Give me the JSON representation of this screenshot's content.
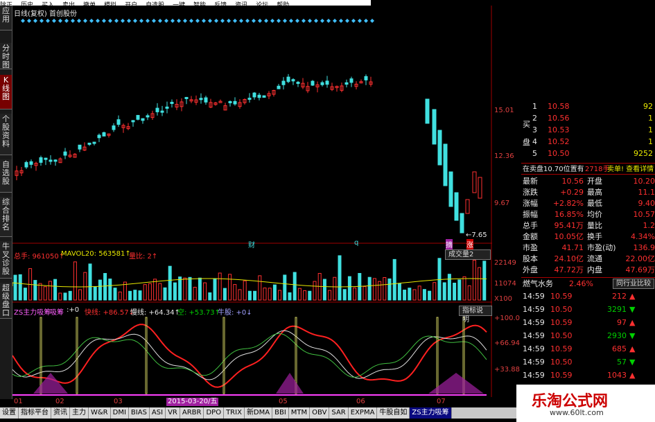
{
  "top_menu": [
    "除正",
    "历史",
    "买入",
    "卖出",
    "撤单",
    "模拟",
    "开户",
    "自选股",
    "一键",
    "智能",
    "反馈",
    "资讯",
    "论坛",
    "帮助"
  ],
  "left_tabs": [
    {
      "label": "应用",
      "active": false
    },
    {
      "label": "分时图",
      "active": false
    },
    {
      "label": "K线图",
      "active": true
    },
    {
      "label": "个股资料",
      "active": false
    },
    {
      "label": "自选股",
      "active": false
    },
    {
      "label": "综合排名",
      "active": false
    },
    {
      "label": "牛叉诊股",
      "active": false
    },
    {
      "label": "超级盘口",
      "active": false
    }
  ],
  "chart": {
    "header": "日线(复权)  首创股份",
    "price_ticks": [
      "15.01",
      "12.36",
      "9.67"
    ],
    "low_marker": "←7.65",
    "markers": [
      "财",
      "q",
      "摘",
      "涨"
    ],
    "volume_info": {
      "total": "总手: 961050↑",
      "mavol": "MAVOL20: 563581↑",
      "ratio": "量比: 2↑"
    },
    "volume_button": "成交量2",
    "volume_ticks": [
      "22149",
      "11074",
      "X100"
    ],
    "indicator_info": {
      "name": "ZS主力吸筹",
      "tag": "吸筹",
      "v0": ":+0",
      "fast": "快线: +86.57↓",
      "slow": "慢线: +64.34↑",
      "empty": "空: +53.73↑",
      "bull": "牛股: +0↓"
    },
    "indicator_button": "指标说明",
    "indicator_ticks": [
      "+100.0",
      "+66.94",
      "+33.88"
    ],
    "date_labels": [
      "01",
      "02",
      "03",
      "05",
      "06",
      "07"
    ],
    "date_highlight": "2015-03-20/五"
  },
  "quote_panel": {
    "side_labels": {
      "buy": "买",
      "sell": "盘"
    },
    "bids": [
      {
        "level": "1",
        "price": "10.58",
        "vol": "92"
      },
      {
        "level": "2",
        "price": "10.56",
        "vol": "1"
      },
      {
        "level": "3",
        "price": "10.53",
        "vol": "1"
      },
      {
        "level": "4",
        "price": "10.52",
        "vol": "1"
      },
      {
        "level": "5",
        "price": "10.50",
        "vol": "9252"
      }
    ],
    "summary_line": {
      "text": "在卖盘10.70位置有",
      "amount": "2718手",
      "link": "卖单! 查看详情"
    },
    "stats": [
      {
        "l1": "最新",
        "v1": "10.56",
        "l2": "开盘",
        "v2": "10.20"
      },
      {
        "l1": "涨跌",
        "v1": "+0.29",
        "l2": "最高",
        "v2": "11.1"
      },
      {
        "l1": "涨幅",
        "v1": "+2.82%",
        "l2": "最低",
        "v2": "9.40"
      },
      {
        "l1": "振幅",
        "v1": "16.85%",
        "l2": "均价",
        "v2": "10.57"
      },
      {
        "l1": "总手",
        "v1": "95.41万",
        "l2": "量比",
        "v2": "1.2"
      },
      {
        "l1": "金额",
        "v1": "10.05亿",
        "l2": "换手",
        "v2": "4.34%"
      },
      {
        "l1": "市盈",
        "v1": "41.71",
        "l2": "市盈(动)",
        "v2": "136.9"
      },
      {
        "l1": "股本",
        "v1": "24.10亿",
        "l2": "流通",
        "v2": "22.00亿"
      },
      {
        "l1": "外盘",
        "v1": "47.72万",
        "l2": "内盘",
        "v2": "47.69万"
      }
    ],
    "industry": {
      "name": "燃气水务",
      "change": "2.46%",
      "button": "同行业比较"
    },
    "ticks": [
      {
        "time": "14:59",
        "price": "10.59",
        "vol": "212",
        "dir": "up"
      },
      {
        "time": "14:59",
        "price": "10.50",
        "vol": "3291",
        "dir": "down"
      },
      {
        "time": "14:59",
        "price": "10.59",
        "vol": "97",
        "dir": "up"
      },
      {
        "time": "14:59",
        "price": "10.50",
        "vol": "2930",
        "dir": "down"
      },
      {
        "time": "14:59",
        "price": "10.59",
        "vol": "685",
        "dir": "up"
      },
      {
        "time": "14:59",
        "price": "10.50",
        "vol": "57",
        "dir": "down"
      },
      {
        "time": "14:59",
        "price": "10.59",
        "vol": "1043",
        "dir": "up"
      }
    ]
  },
  "bottom_tabs": [
    {
      "label": "设置",
      "active": false
    },
    {
      "label": "指标平台",
      "active": false
    },
    {
      "label": "资讯",
      "active": false
    },
    {
      "label": "主力",
      "active": false
    },
    {
      "label": "W&R",
      "active": false
    },
    {
      "label": "DMI",
      "active": false
    },
    {
      "label": "BIAS",
      "active": false
    },
    {
      "label": "ASI",
      "active": false
    },
    {
      "label": "VR",
      "active": false
    },
    {
      "label": "ARBR",
      "active": false
    },
    {
      "label": "DPO",
      "active": false
    },
    {
      "label": "TRIX",
      "active": false
    },
    {
      "label": "新DMA",
      "active": false
    },
    {
      "label": "BBI",
      "active": false
    },
    {
      "label": "MTM",
      "active": false
    },
    {
      "label": "OBV",
      "active": false
    },
    {
      "label": "SAR",
      "active": false
    },
    {
      "label": "EXPMA",
      "active": false
    },
    {
      "label": "牛股自如",
      "active": false
    },
    {
      "label": "ZS主力吸筹",
      "active": true
    }
  ],
  "watermark": {
    "title": "乐淘公式网",
    "url": "www.60lt.com"
  },
  "colors": {
    "up": "#ff3030",
    "down": "#40e0e0",
    "accent_active_tab": "#0a0a80"
  }
}
